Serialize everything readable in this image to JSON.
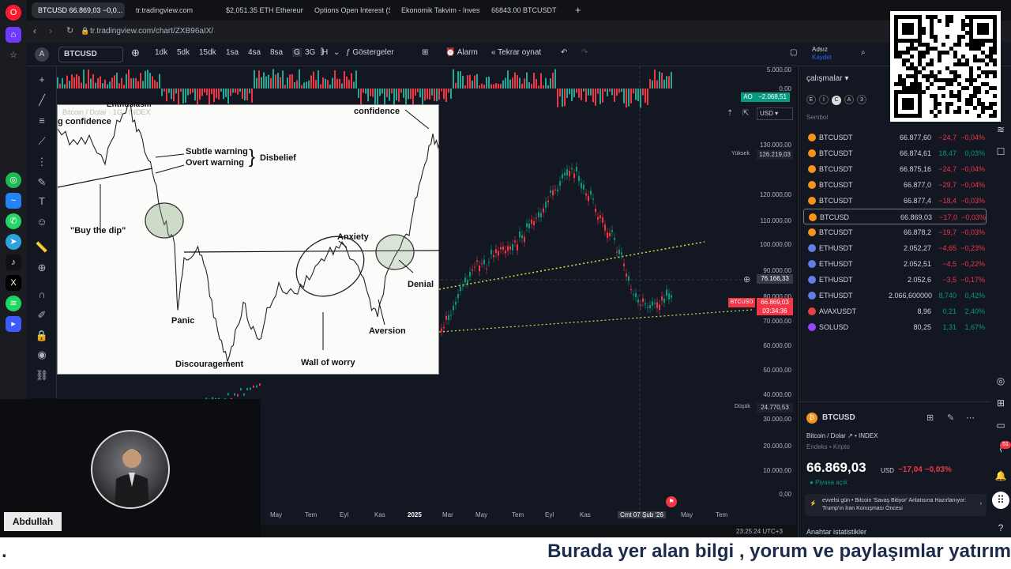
{
  "browser": {
    "tabs": [
      {
        "label": "BTCUSD 66.869,03 −0,0..."
      },
      {
        "label": "tr.tradingview.com"
      },
      {
        "label": "$2,051.35 ETH Ethereum l..."
      },
      {
        "label": "Options Open Interest (St..."
      },
      {
        "label": "Ekonomik Takvim - Invest..."
      },
      {
        "label": "66843.00 BTCUSDT"
      }
    ],
    "url": "tr.tradingview.com/chart/ZXB96aIX/"
  },
  "toolbar": {
    "avatar_letter": "A",
    "symbol": "BTCUSD",
    "intervals": [
      "1dk",
      "5dk",
      "15dk",
      "1sa",
      "4sa",
      "8sa",
      "G",
      "3G",
      "H"
    ],
    "active_interval": "G",
    "indicators_label": "Göstergeler",
    "alarm_label": "Alarm",
    "replay_label": "Tekrar oynat",
    "user_name": "Adsız",
    "user_status": "Kaydet",
    "currency": "USD"
  },
  "chart": {
    "ao_label": "AO",
    "ao_value": "−2.068,51",
    "high_label": "Yüksek",
    "high_value": "126.219,03",
    "low_label": "Düşük",
    "low_value": "24.770,53",
    "crosshair_value": "76.166,33",
    "current_symbol": "BTCUSD",
    "current_price": "66.869,03",
    "countdown": "03:34:36",
    "price_ticks": [
      "5.000,00",
      "0,00",
      "130.000,00",
      "120.000,00",
      "110.000,00",
      "100.000,00",
      "90.000,00",
      "80.000,00",
      "70.000,00",
      "60.000,00",
      "50.000,00",
      "40.000,00",
      "30.000,00",
      "20.000,00",
      "10.000,00",
      "0,00",
      "−10.000,00"
    ],
    "time_ticks": [
      "May",
      "Tem",
      "Eyl",
      "Kas",
      "2025",
      "Mar",
      "May",
      "Tem",
      "Eyl",
      "Kas",
      "Cmt 07 Şub '26",
      "May",
      "Tem"
    ],
    "clock": "23:25:24 UTC+3"
  },
  "inset": {
    "header": "Bitcoin / Dolar · 1G · INDEX",
    "labels": {
      "enthusiasm": "Enthusiasm",
      "confidence_top_left": "g confidence",
      "confidence": "confidence",
      "subtle_warning": "Subtle warning",
      "overt_warning": "Overt warning",
      "disbelief": "Disbelief",
      "buy_the_dip": "\"Buy the dip\"",
      "panic": "Panic",
      "anxiety": "Anxiety",
      "denial": "Denial",
      "aversion": "Aversion",
      "discouragement": "Discouragement",
      "wall_of_worry": "Wall of worry"
    }
  },
  "watchlist": {
    "title": "çalışmalar",
    "column_symbol": "Sembol",
    "rows": [
      {
        "sym": "BTCUSDT",
        "last": "66.877,60",
        "chg": "−24,7",
        "pct": "−0,04%",
        "color": "#f7931a",
        "dir": "red"
      },
      {
        "sym": "BTCUSDT",
        "last": "66.874,61",
        "chg": "18,47",
        "pct": "0,03%",
        "color": "#f7931a",
        "dir": "green"
      },
      {
        "sym": "BTCUSDT",
        "last": "66.875,16",
        "chg": "−24,7",
        "pct": "−0,04%",
        "color": "#f7931a",
        "dir": "red"
      },
      {
        "sym": "BTCUSDT",
        "last": "66.877,0",
        "chg": "−29,7",
        "pct": "−0,04%",
        "color": "#f7931a",
        "dir": "red"
      },
      {
        "sym": "BTCUSDT",
        "last": "66.877,4",
        "chg": "−18,4",
        "pct": "−0,03%",
        "color": "#f7931a",
        "dir": "red"
      },
      {
        "sym": "BTCUSD",
        "last": "66.869,03",
        "chg": "−17,0",
        "pct": "−0,03%",
        "color": "#f7931a",
        "dir": "red"
      },
      {
        "sym": "BTCUSDT",
        "last": "66.878,2",
        "chg": "−19,7",
        "pct": "−0,03%",
        "color": "#f7931a",
        "dir": "red"
      },
      {
        "sym": "ETHUSDT",
        "last": "2.052,27",
        "chg": "−4,65",
        "pct": "−0,23%",
        "color": "#627eea",
        "dir": "red"
      },
      {
        "sym": "ETHUSDT",
        "last": "2.052,51",
        "chg": "−4,5",
        "pct": "−0,22%",
        "color": "#627eea",
        "dir": "red"
      },
      {
        "sym": "ETHUSDT",
        "last": "2.052,6",
        "chg": "−3,5",
        "pct": "−0,17%",
        "color": "#627eea",
        "dir": "red"
      },
      {
        "sym": "ETHUSDT",
        "last": "2.066,600000",
        "chg": "8,740",
        "pct": "0,42%",
        "color": "#627eea",
        "dir": "green"
      },
      {
        "sym": "AVAXUSDT",
        "last": "8,96",
        "chg": "0,21",
        "pct": "2,40%",
        "color": "#e84142",
        "dir": "green"
      },
      {
        "sym": "SOLUSD",
        "last": "80,25",
        "chg": "1,31",
        "pct": "1,67%",
        "color": "#9945ff",
        "dir": "green"
      }
    ]
  },
  "details": {
    "symbol": "BTCUSD",
    "name": "Bitcoin / Dolar",
    "exchange": "INDEX",
    "category": "Endeks • Kripto",
    "price": "66.869,03",
    "currency": "USD",
    "change": "−17,04",
    "change_pct": "−0,03%",
    "market_status": "Piyasa açık",
    "news": "evvelsi gün • Bitcoin 'Savaş Bitiyor' Anlatısına Hazırlanıyor: Trump'ın İran Konuşması Öncesi",
    "stats_label": "Anahtar istatistikler",
    "notif_count": "51"
  },
  "overlay": {
    "presenter": "Abdullah",
    "ticker_prefix": ".",
    "ticker": "Burada yer alan bilgi , yorum ve paylaşımlar yatırım"
  }
}
